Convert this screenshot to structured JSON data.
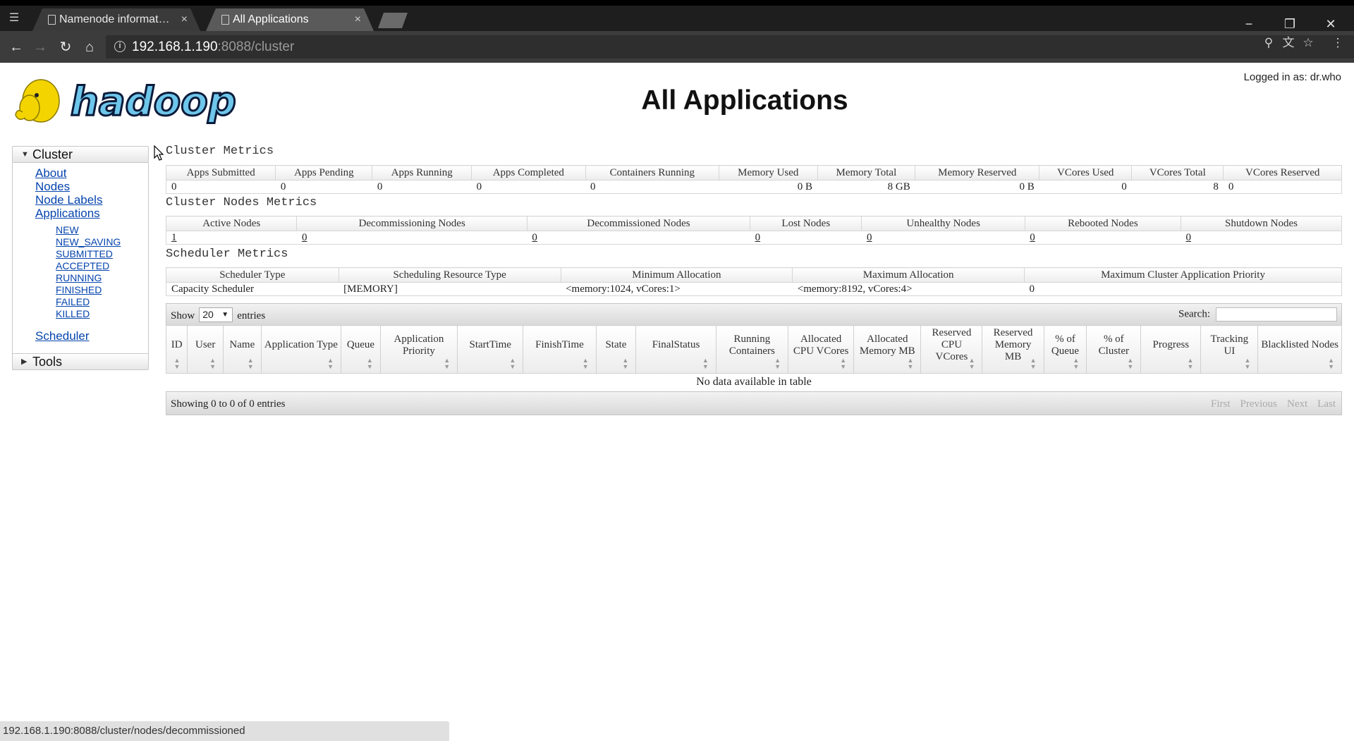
{
  "browser": {
    "tabs": [
      {
        "title": "Namenode information"
      },
      {
        "title": "All Applications"
      }
    ],
    "url_host": "192.168.1.190",
    "url_path": ":8088/cluster",
    "status_url": "192.168.1.190:8088/cluster/nodes/decommissioned"
  },
  "header": {
    "title": "All Applications",
    "logged_in": "Logged in as: dr.who",
    "logo_text": "hadoop"
  },
  "sidebar": {
    "cluster_label": "Cluster",
    "links": [
      "About",
      "Nodes",
      "Node Labels",
      "Applications"
    ],
    "app_states": [
      "NEW",
      "NEW_SAVING",
      "SUBMITTED",
      "ACCEPTED",
      "RUNNING",
      "FINISHED",
      "FAILED",
      "KILLED"
    ],
    "scheduler_label": "Scheduler",
    "tools_label": "Tools"
  },
  "cluster_metrics": {
    "title": "Cluster Metrics",
    "headers": [
      "Apps Submitted",
      "Apps Pending",
      "Apps Running",
      "Apps Completed",
      "Containers Running",
      "Memory Used",
      "Memory Total",
      "Memory Reserved",
      "VCores Used",
      "VCores Total",
      "VCores Reserved"
    ],
    "values": [
      "0",
      "0",
      "0",
      "0",
      "0",
      "0 B",
      "8 GB",
      "0 B",
      "0",
      "8",
      "0"
    ]
  },
  "nodes_metrics": {
    "title": "Cluster Nodes Metrics",
    "headers": [
      "Active Nodes",
      "Decommissioning Nodes",
      "Decommissioned Nodes",
      "Lost Nodes",
      "Unhealthy Nodes",
      "Rebooted Nodes",
      "Shutdown Nodes"
    ],
    "values": [
      "1",
      "0",
      "0",
      "0",
      "0",
      "0",
      "0"
    ]
  },
  "scheduler_metrics": {
    "title": "Scheduler Metrics",
    "headers": [
      "Scheduler Type",
      "Scheduling Resource Type",
      "Minimum Allocation",
      "Maximum Allocation",
      "Maximum Cluster Application Priority"
    ],
    "values": [
      "Capacity Scheduler",
      "[MEMORY]",
      "<memory:1024, vCores:1>",
      "<memory:8192, vCores:4>",
      "0"
    ]
  },
  "apps_table": {
    "show_label": "Show",
    "entries_value": "20",
    "entries_label": "entries",
    "search_label": "Search:",
    "columns": [
      "ID",
      "User",
      "Name",
      "Application Type",
      "Queue",
      "Application Priority",
      "StartTime",
      "FinishTime",
      "State",
      "FinalStatus",
      "Running Containers",
      "Allocated CPU VCores",
      "Allocated Memory MB",
      "Reserved CPU VCores",
      "Reserved Memory MB",
      "% of Queue",
      "% of Cluster",
      "Progress",
      "Tracking UI",
      "Blacklisted Nodes"
    ],
    "empty_message": "No data available in table",
    "showing_info": "Showing 0 to 0 of 0 entries",
    "pager": [
      "First",
      "Previous",
      "Next",
      "Last"
    ]
  }
}
